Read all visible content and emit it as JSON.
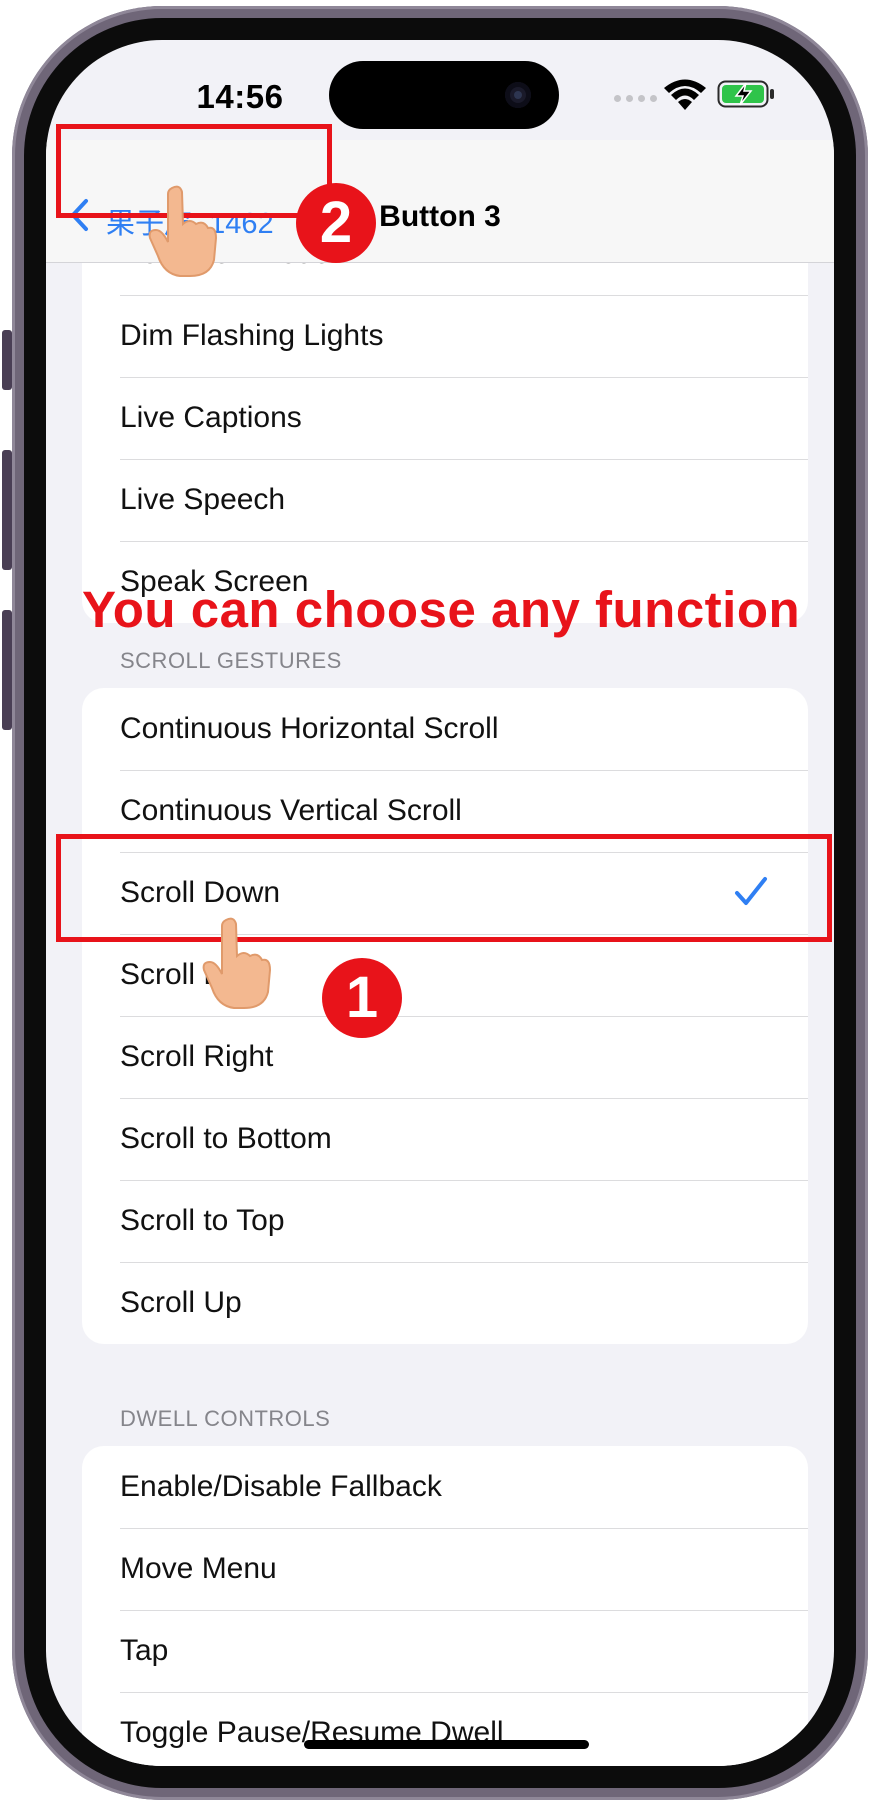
{
  "status_bar": {
    "time": "14:56"
  },
  "nav": {
    "back_label": "果子皮_1462",
    "title": "Button 3"
  },
  "top_section": {
    "partial_item": "Detection Mode",
    "items": [
      "Dim Flashing Lights",
      "Live Captions",
      "Live Speech",
      "Speak Screen"
    ]
  },
  "annotation": {
    "banner": "You can choose any function",
    "step1": "1",
    "step2": "2",
    "color": "#e8131a"
  },
  "scroll_gestures": {
    "header": "SCROLL GESTURES",
    "items": [
      "Continuous Horizontal Scroll",
      "Continuous Vertical Scroll",
      "Scroll Down",
      "Scroll Left",
      "Scroll Right",
      "Scroll to Bottom",
      "Scroll to Top",
      "Scroll Up"
    ],
    "selected": "Scroll Down"
  },
  "dwell_controls": {
    "header": "DWELL CONTROLS",
    "items": [
      "Enable/Disable Fallback",
      "Move Menu",
      "Tap",
      "Toggle Pause/Resume Dwell"
    ]
  },
  "colors": {
    "accent": "#2f7ff3",
    "annotation": "#e8131a",
    "background": "#f2f2f7"
  }
}
